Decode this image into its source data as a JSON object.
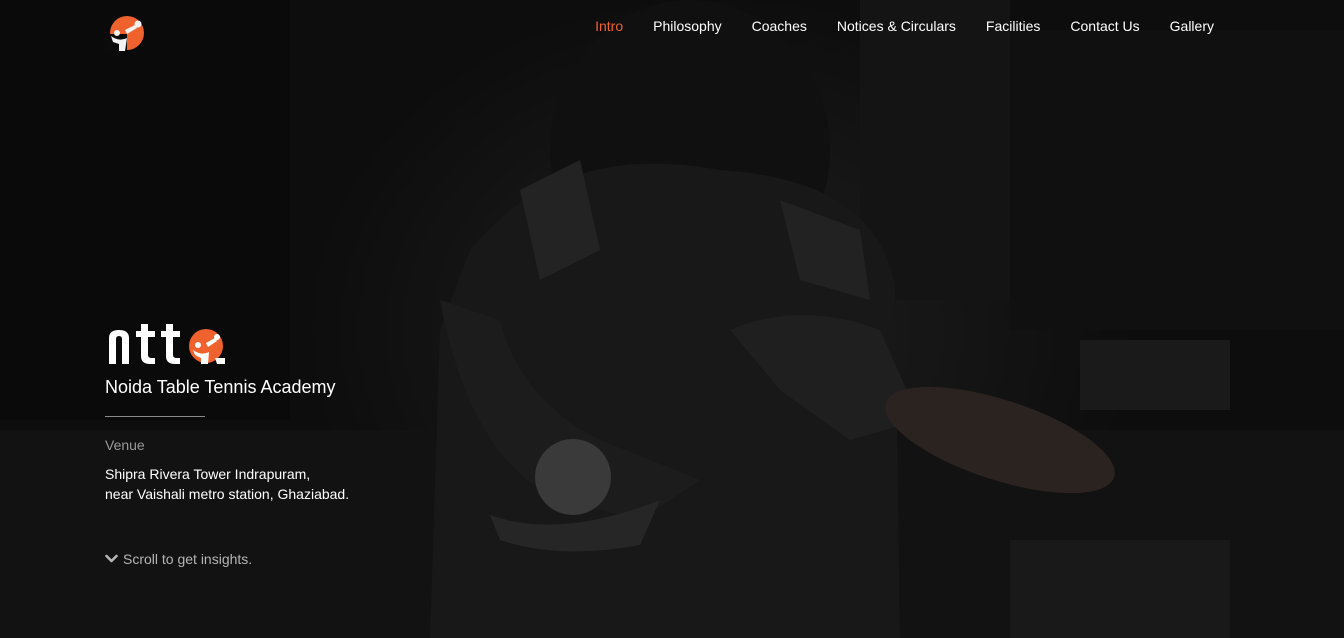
{
  "brand": {
    "logo_icon": "ping-pong-player-icon",
    "accent_color": "#f0622d"
  },
  "nav": {
    "items": [
      {
        "label": "Intro",
        "active": true
      },
      {
        "label": "Philosophy",
        "active": false
      },
      {
        "label": "Coaches",
        "active": false
      },
      {
        "label": "Notices & Circulars",
        "active": false
      },
      {
        "label": "Facilities",
        "active": false
      },
      {
        "label": "Contact Us",
        "active": false
      },
      {
        "label": "Gallery",
        "active": false
      }
    ]
  },
  "hero": {
    "logo_text": "ntt",
    "academy_name": "Noida Table Tennis Academy",
    "venue_label": "Venue",
    "venue_line1": "Shipra Rivera Tower Indrapuram,",
    "venue_line2": "near Vaishali metro station, Ghaziabad.",
    "scroll_hint": "Scroll to get insights.",
    "scroll_icon": "chevron-down-icon"
  }
}
